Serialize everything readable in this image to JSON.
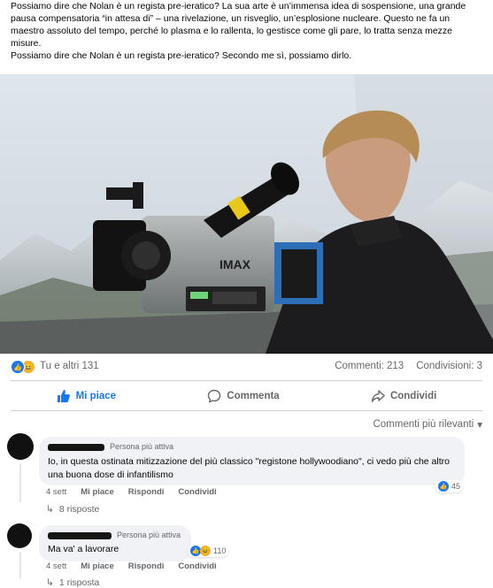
{
  "post": {
    "paragraph1": "Possiamo dire che Nolan è un regista pre-ieratico? La sua arte è un’immensa idea di sospensione, una grande pausa compensatoria “in attesa di” – una rivelazione, un risveglio, un’esplosione nucleare. Questo ne fa un maestro assoluto del tempo, perché lo plasma e lo rallenta, lo gestisce come gli pare, lo tratta senza mezze misure.",
    "paragraph2": "Possiamo dire che Nolan è un regista pre-ieratico? Secondo me sì, possiamo dirlo.",
    "camera_brand": "IMAX"
  },
  "reactions": {
    "icons": [
      "like-icon",
      "haha-icon"
    ],
    "summary": "Tu e altri 131",
    "comments": "Commenti: 213",
    "shares": "Condivisioni: 3"
  },
  "actions": {
    "like": "Mi piace",
    "comment": "Commenta",
    "share": "Condividi",
    "like_color": "#1877f2"
  },
  "sort_label": "Commenti più rilevanti",
  "comments": [
    {
      "badge": "Persona più attiva",
      "text": "Io, in questa ostinata mitizzazione del più classico \"registone hollywoodiano\", ci vedo più che altro una buona dose di infantilismo",
      "time": "4 sett",
      "like": "Mi piace",
      "reply": "Rispondi",
      "share": "Condividi",
      "reaction_count": "45",
      "replies": "8 risposte"
    },
    {
      "badge": "Persona più attiva",
      "text": "Ma va' a lavorare",
      "time": "4 sett",
      "like": "Mi piace",
      "reply": "Rispondi",
      "share": "Condividi",
      "reaction_count": "110",
      "replies": "1 risposta"
    }
  ]
}
